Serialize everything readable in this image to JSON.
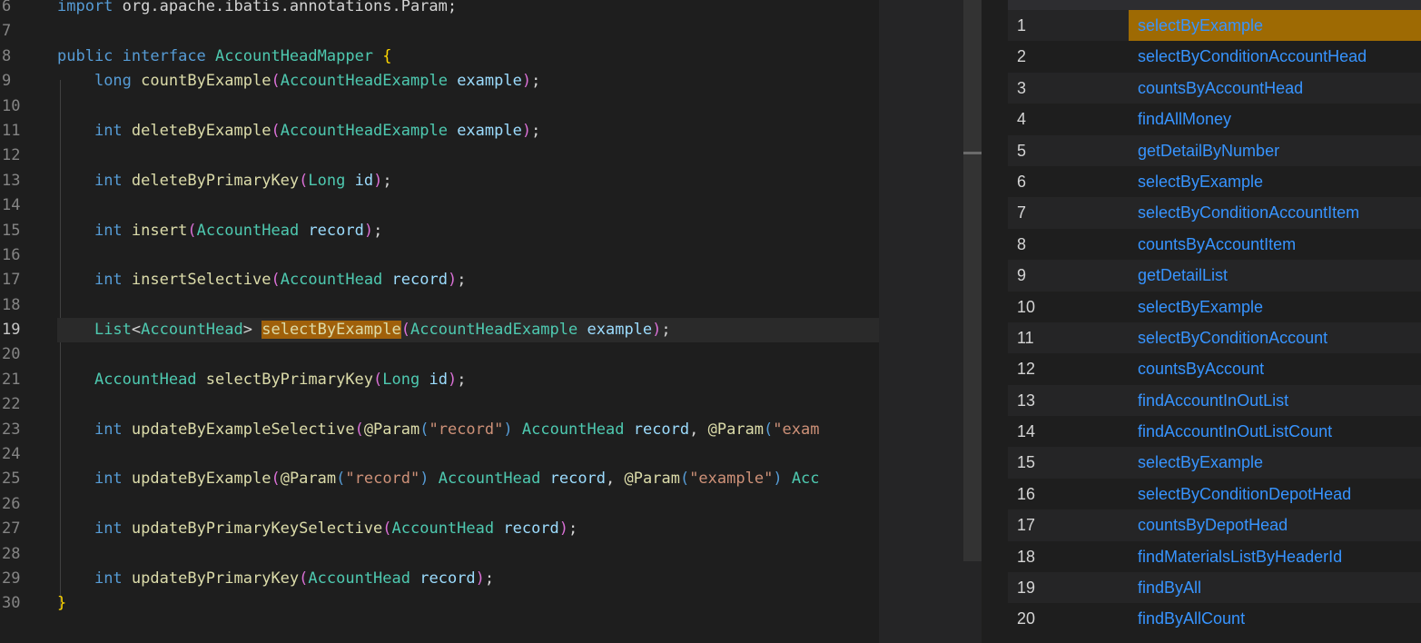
{
  "editor": {
    "active_line": 19,
    "line_numbers": [
      "6",
      "7",
      "8",
      "9",
      "10",
      "11",
      "12",
      "13",
      "14",
      "15",
      "16",
      "17",
      "18",
      "19",
      "20",
      "21",
      "22",
      "23",
      "24",
      "25",
      "26",
      "27",
      "28",
      "29",
      "30"
    ],
    "import_line": {
      "kw": "import",
      "rest": " org.apache.ibatis.annotations.Param;"
    },
    "iface": {
      "kw1": "public",
      "kw2": "interface",
      "name": "AccountHeadMapper",
      "brace": "{"
    },
    "close_brace": "}",
    "methods": {
      "countByExample": {
        "ret": "long",
        "name": "countByExample",
        "ptype": "AccountHeadExample",
        "pname": "example"
      },
      "deleteByExample": {
        "ret": "int",
        "name": "deleteByExample",
        "ptype": "AccountHeadExample",
        "pname": "example"
      },
      "deleteByPrimaryKey": {
        "ret": "int",
        "name": "deleteByPrimaryKey",
        "ptype": "Long",
        "pname": "id"
      },
      "insert": {
        "ret": "int",
        "name": "insert",
        "ptype": "AccountHead",
        "pname": "record"
      },
      "insertSelective": {
        "ret": "int",
        "name": "insertSelective",
        "ptype": "AccountHead",
        "pname": "record"
      },
      "selectByExample": {
        "ret": "List",
        "generic": "AccountHead",
        "name": "selectByExample",
        "ptype": "AccountHeadExample",
        "pname": "example"
      },
      "selectByPrimaryKey": {
        "ret": "AccountHead",
        "name": "selectByPrimaryKey",
        "ptype": "Long",
        "pname": "id"
      },
      "updateByExampleSelective": {
        "ret": "int",
        "name": "updateByExampleSelective",
        "ann": "@Param",
        "s1": "\"record\"",
        "ptype": "AccountHead",
        "pname": "record",
        "ann2": "@Param",
        "s2_partial": "\"exam"
      },
      "updateByExample": {
        "ret": "int",
        "name": "updateByExample",
        "ann": "@Param",
        "s1": "\"record\"",
        "ptype": "AccountHead",
        "pname": "record",
        "ann2": "@Param",
        "s2": "\"example\"",
        "tail_partial": "Acc"
      },
      "updateByPrimaryKeySelective": {
        "ret": "int",
        "name": "updateByPrimaryKeySelective",
        "ptype": "AccountHead",
        "pname": "record"
      },
      "updateByPrimaryKey": {
        "ret": "int",
        "name": "updateByPrimaryKey",
        "ptype": "AccountHead",
        "pname": "record"
      }
    }
  },
  "results": [
    {
      "n": "1",
      "name": "selectByExample"
    },
    {
      "n": "2",
      "name": "selectByConditionAccountHead"
    },
    {
      "n": "3",
      "name": "countsByAccountHead"
    },
    {
      "n": "4",
      "name": "findAllMoney"
    },
    {
      "n": "5",
      "name": "getDetailByNumber"
    },
    {
      "n": "6",
      "name": "selectByExample"
    },
    {
      "n": "7",
      "name": "selectByConditionAccountItem"
    },
    {
      "n": "8",
      "name": "countsByAccountItem"
    },
    {
      "n": "9",
      "name": "getDetailList"
    },
    {
      "n": "10",
      "name": "selectByExample"
    },
    {
      "n": "11",
      "name": "selectByConditionAccount"
    },
    {
      "n": "12",
      "name": "countsByAccount"
    },
    {
      "n": "13",
      "name": "findAccountInOutList"
    },
    {
      "n": "14",
      "name": "findAccountInOutListCount"
    },
    {
      "n": "15",
      "name": "selectByExample"
    },
    {
      "n": "16",
      "name": "selectByConditionDepotHead"
    },
    {
      "n": "17",
      "name": "countsByDepotHead"
    },
    {
      "n": "18",
      "name": "findMaterialsListByHeaderId"
    },
    {
      "n": "19",
      "name": "findByAll"
    },
    {
      "n": "20",
      "name": "findByAllCount"
    }
  ],
  "selected_result": "1",
  "colors": {
    "keyword": "#569cd6",
    "type": "#4ec9b0",
    "function": "#dcdcaa",
    "param": "#9cdcfe",
    "string": "#ce9178",
    "highlight": "#a0600a",
    "link": "#3794ff"
  }
}
